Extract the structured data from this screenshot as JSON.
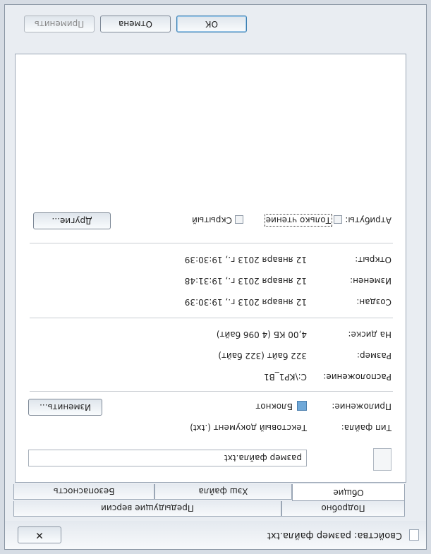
{
  "window": {
    "title": "Свойства: размер файла.txt",
    "close_glyph": "✕"
  },
  "tabs_row1": [
    "Подробно",
    "Предыдущие версии"
  ],
  "tabs_row2": [
    "Общие",
    "Хэш файла",
    "Безопасность"
  ],
  "general": {
    "filename": "размер файла.txt",
    "file_type_label": "Тип файла:",
    "file_type_value": "Текстовый документ (.txt)",
    "app_label": "Приложение:",
    "app_value": "Блокнот",
    "change_button": "Изменить...",
    "location_label": "Расположение:",
    "location_value": "C:\\KP1_B1",
    "size_label": "Размер:",
    "size_value": "322 байт (322 байт)",
    "disk_label": "На диске:",
    "disk_value": "4,00 КБ (4 096 байт)",
    "created_label": "Создан:",
    "created_value": "12 января 2013 г., 19:30:39",
    "modified_label": "Изменен:",
    "modified_value": "12 января 2013 г., 19:31:48",
    "opened_label": "Открыт:",
    "opened_value": "12 января 2013 г., 19:30:39",
    "attributes_label": "Атрибуты:",
    "readonly_label": "Только чтение",
    "hidden_label": "Скрытый",
    "other_button": "Другие..."
  },
  "footer": {
    "ok": "ОК",
    "cancel": "Отмена",
    "apply": "Применить"
  }
}
